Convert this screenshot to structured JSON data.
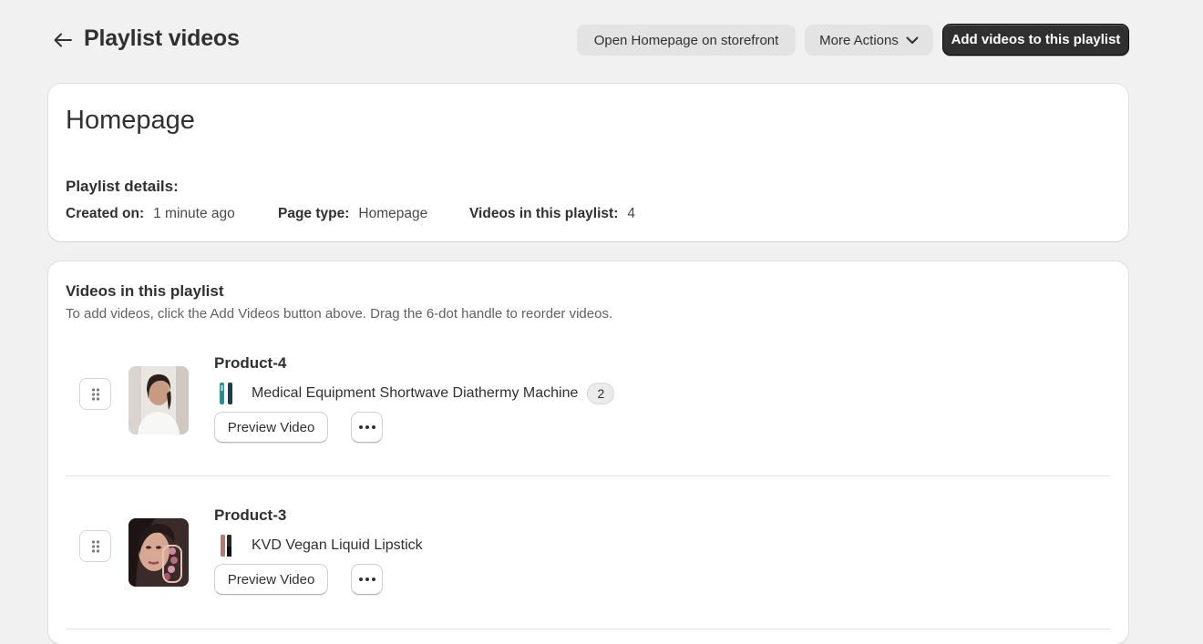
{
  "header": {
    "title": "Playlist videos",
    "open_storefront_label": "Open Homepage on storefront",
    "more_actions_label": "More Actions",
    "add_videos_label": "Add videos to this playlist"
  },
  "playlist": {
    "name": "Homepage",
    "details_heading": "Playlist details:",
    "created_on_label": "Created on:",
    "created_on_value": "1 minute ago",
    "page_type_label": "Page type:",
    "page_type_value": "Homepage",
    "video_count_label": "Videos in this playlist:",
    "video_count_value": "4"
  },
  "videos_section": {
    "heading": "Videos in this playlist",
    "subtitle": "To add videos, click the Add Videos button above. Drag the 6-dot handle to reorder videos.",
    "items": [
      {
        "title": "Product-4",
        "product_name": "Medical Equipment Shortwave Diathermy Machine",
        "product_count": "2",
        "preview_label": "Preview Video"
      },
      {
        "title": "Product-3",
        "product_name": "KVD Vegan Liquid Lipstick",
        "preview_label": "Preview Video"
      }
    ]
  },
  "colors": {
    "background": "#f1f1f1",
    "card": "#ffffff",
    "primary_button": "#303030",
    "secondary_button": "#e3e3e3"
  }
}
